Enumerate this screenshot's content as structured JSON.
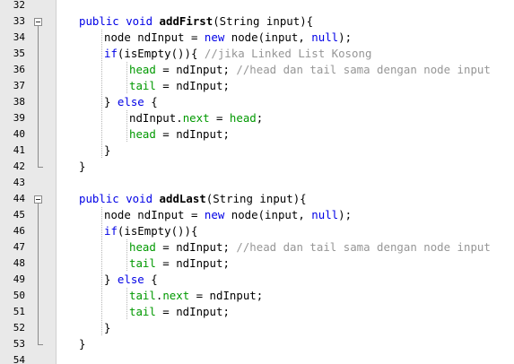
{
  "colors": {
    "default": "#000000",
    "keyword": "#0000e6",
    "field": "#009900",
    "comment": "#969696",
    "method": "#000000"
  },
  "gutter": {
    "line_numbers": [
      "32",
      "33",
      "34",
      "35",
      "36",
      "37",
      "38",
      "39",
      "40",
      "41",
      "42",
      "43",
      "44",
      "45",
      "46",
      "47",
      "48",
      "49",
      "50",
      "51",
      "52",
      "53",
      "54"
    ]
  },
  "code_lines": [
    {
      "num": "32",
      "indent": 0,
      "tokens": []
    },
    {
      "num": "33",
      "indent": 1,
      "tokens": [
        {
          "t": "public void ",
          "c": "keyword"
        },
        {
          "t": "addFirst",
          "c": "method",
          "b": true
        },
        {
          "t": "(String input){",
          "c": "default"
        }
      ]
    },
    {
      "num": "34",
      "indent": 2,
      "tokens": [
        {
          "t": "node ndInput = ",
          "c": "default"
        },
        {
          "t": "new",
          "c": "keyword"
        },
        {
          "t": " node(input, ",
          "c": "default"
        },
        {
          "t": "null",
          "c": "keyword"
        },
        {
          "t": ");",
          "c": "default"
        }
      ]
    },
    {
      "num": "35",
      "indent": 2,
      "tokens": [
        {
          "t": "if",
          "c": "keyword"
        },
        {
          "t": "(isEmpty()){ ",
          "c": "default"
        },
        {
          "t": "//jika Linked List Kosong",
          "c": "comment"
        }
      ]
    },
    {
      "num": "36",
      "indent": 3,
      "tokens": [
        {
          "t": "head",
          "c": "field"
        },
        {
          "t": " = ndInput; ",
          "c": "default"
        },
        {
          "t": "//head dan tail sama dengan node input",
          "c": "comment"
        }
      ]
    },
    {
      "num": "37",
      "indent": 3,
      "tokens": [
        {
          "t": "tail",
          "c": "field"
        },
        {
          "t": " = ndInput;",
          "c": "default"
        }
      ]
    },
    {
      "num": "38",
      "indent": 2,
      "tokens": [
        {
          "t": "} ",
          "c": "default"
        },
        {
          "t": "else",
          "c": "keyword"
        },
        {
          "t": " {",
          "c": "default"
        }
      ]
    },
    {
      "num": "39",
      "indent": 3,
      "tokens": [
        {
          "t": "ndInput.",
          "c": "default"
        },
        {
          "t": "next",
          "c": "field"
        },
        {
          "t": " = ",
          "c": "default"
        },
        {
          "t": "head",
          "c": "field"
        },
        {
          "t": ";",
          "c": "default"
        }
      ]
    },
    {
      "num": "40",
      "indent": 3,
      "tokens": [
        {
          "t": "head",
          "c": "field"
        },
        {
          "t": " = ndInput;",
          "c": "default"
        }
      ]
    },
    {
      "num": "41",
      "indent": 2,
      "tokens": [
        {
          "t": "}",
          "c": "default"
        }
      ]
    },
    {
      "num": "42",
      "indent": 1,
      "tokens": [
        {
          "t": "}",
          "c": "default"
        }
      ]
    },
    {
      "num": "43",
      "indent": 0,
      "tokens": []
    },
    {
      "num": "44",
      "indent": 1,
      "tokens": [
        {
          "t": "public void ",
          "c": "keyword"
        },
        {
          "t": "addLast",
          "c": "method",
          "b": true
        },
        {
          "t": "(String input){",
          "c": "default"
        }
      ]
    },
    {
      "num": "45",
      "indent": 2,
      "tokens": [
        {
          "t": "node ndInput = ",
          "c": "default"
        },
        {
          "t": "new",
          "c": "keyword"
        },
        {
          "t": " node(input, ",
          "c": "default"
        },
        {
          "t": "null",
          "c": "keyword"
        },
        {
          "t": ");",
          "c": "default"
        }
      ]
    },
    {
      "num": "46",
      "indent": 2,
      "tokens": [
        {
          "t": "if",
          "c": "keyword"
        },
        {
          "t": "(isEmpty()){",
          "c": "default"
        }
      ]
    },
    {
      "num": "47",
      "indent": 3,
      "tokens": [
        {
          "t": "head",
          "c": "field"
        },
        {
          "t": " = ndInput; ",
          "c": "default"
        },
        {
          "t": "//head dan tail sama dengan node input",
          "c": "comment"
        }
      ]
    },
    {
      "num": "48",
      "indent": 3,
      "tokens": [
        {
          "t": "tail",
          "c": "field"
        },
        {
          "t": " = ndInput;",
          "c": "default"
        }
      ]
    },
    {
      "num": "49",
      "indent": 2,
      "tokens": [
        {
          "t": "} ",
          "c": "default"
        },
        {
          "t": "else",
          "c": "keyword"
        },
        {
          "t": " {",
          "c": "default"
        }
      ]
    },
    {
      "num": "50",
      "indent": 3,
      "tokens": [
        {
          "t": "tail",
          "c": "field"
        },
        {
          "t": ".",
          "c": "default"
        },
        {
          "t": "next",
          "c": "field"
        },
        {
          "t": " = ndInput;",
          "c": "default"
        }
      ]
    },
    {
      "num": "51",
      "indent": 3,
      "tokens": [
        {
          "t": "tail",
          "c": "field"
        },
        {
          "t": " = ndInput;",
          "c": "default"
        }
      ]
    },
    {
      "num": "52",
      "indent": 2,
      "tokens": [
        {
          "t": "}",
          "c": "default"
        }
      ]
    },
    {
      "num": "53",
      "indent": 1,
      "tokens": [
        {
          "t": "}",
          "c": "default"
        }
      ]
    },
    {
      "num": "54",
      "indent": 0,
      "tokens": []
    }
  ]
}
